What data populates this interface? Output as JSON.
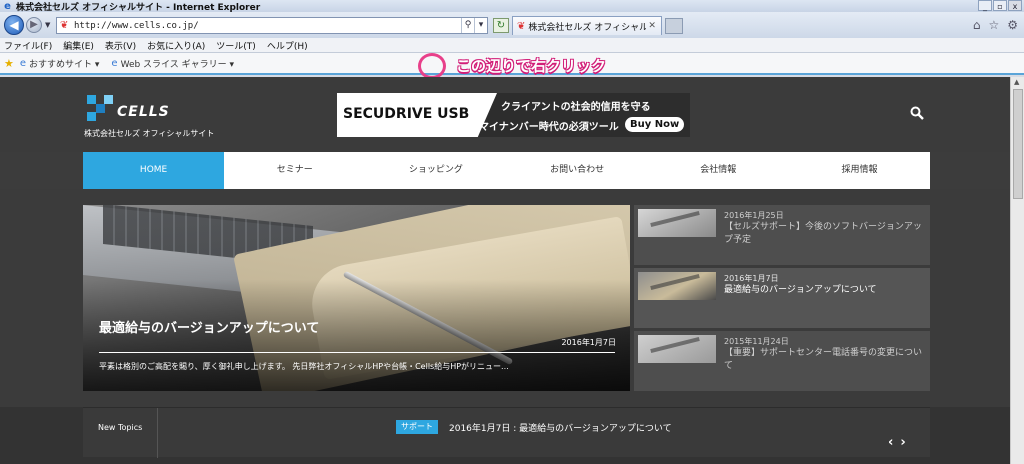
{
  "window": {
    "title": "株式会社セルズ オフィシャルサイト - Internet Explorer",
    "buttons": [
      "_",
      "▫",
      "x"
    ]
  },
  "browser": {
    "url": "http://www.cells.co.jp/",
    "tab_label": "株式会社セルズ オフィシャル...",
    "menu": [
      "ファイル(F)",
      "編集(E)",
      "表示(V)",
      "お気に入り(A)",
      "ツール(T)",
      "ヘルプ(H)"
    ],
    "favorites": [
      "おすすめサイト ▾",
      "Web スライス ギャラリー ▾"
    ]
  },
  "annotation": {
    "text": "この辺りで右クリック",
    "color": "#e8408a"
  },
  "site": {
    "logo_name": "CELLS",
    "logo_sub": "株式会社セルズ オフィシャルサイト",
    "banner": {
      "product": "SECUDRIVE USB",
      "line1": "クライアントの社会的信用を守る",
      "line2": "マイナンバー時代の必須ツール",
      "cta": "Buy Now"
    },
    "nav": [
      "HOME",
      "セミナー",
      "ショッピング",
      "お問い合わせ",
      "会社情報",
      "採用情報"
    ],
    "accent_color": "#2ea7e0",
    "hero": {
      "title": "最適給与のバージョンアップについて",
      "date": "2016年1月7日",
      "excerpt": "平素は格別のご高配を賜り、厚く御礼申し上げます。 先日弊社オフィシャルHPや台帳・Cells給与HPがリニュー..."
    },
    "side": [
      {
        "date": "2016年1月25日",
        "text": "【セルズサポート】今後のソフトバージョンアップ予定"
      },
      {
        "date": "2016年1月7日",
        "text": "最適給与のバージョンアップについて"
      },
      {
        "date": "2015年11月24日",
        "text": "【重要】サポートセンター電話番号の変更について"
      }
    ],
    "topics": {
      "label": "New Topics",
      "badge": "サポート",
      "headline": "2016年1月7日 : 最適給与のバージョンアップについて",
      "prev": "‹",
      "next": "›"
    }
  }
}
